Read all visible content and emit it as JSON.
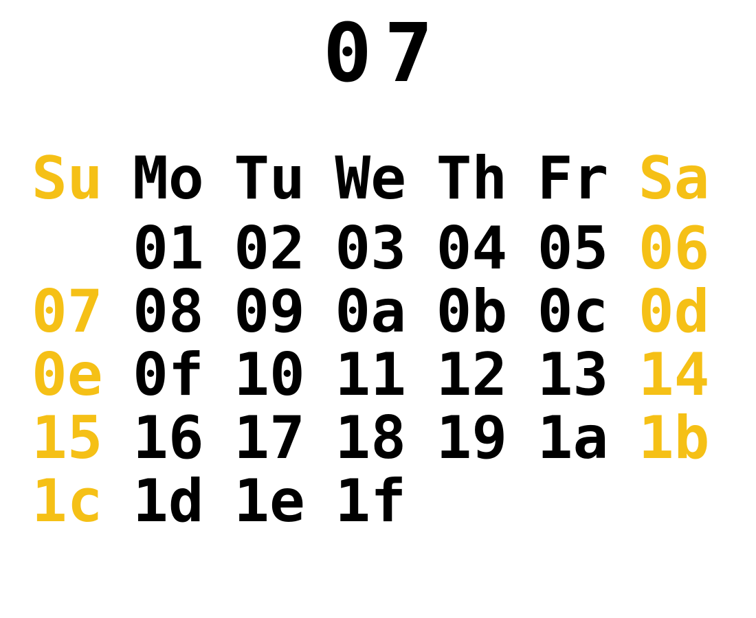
{
  "month_title": "07",
  "colors": {
    "weekend": "#f5c016",
    "weekday": "#000000",
    "background": "#ffffff"
  },
  "weekdays": [
    "Su",
    "Mo",
    "Tu",
    "We",
    "Th",
    "Fr",
    "Sa"
  ],
  "weeks": [
    [
      "",
      "01",
      "02",
      "03",
      "04",
      "05",
      "06"
    ],
    [
      "07",
      "08",
      "09",
      "0a",
      "0b",
      "0c",
      "0d"
    ],
    [
      "0e",
      "0f",
      "10",
      "11",
      "12",
      "13",
      "14"
    ],
    [
      "15",
      "16",
      "17",
      "18",
      "19",
      "1a",
      "1b"
    ],
    [
      "1c",
      "1d",
      "1e",
      "1f",
      "",
      "",
      ""
    ]
  ]
}
